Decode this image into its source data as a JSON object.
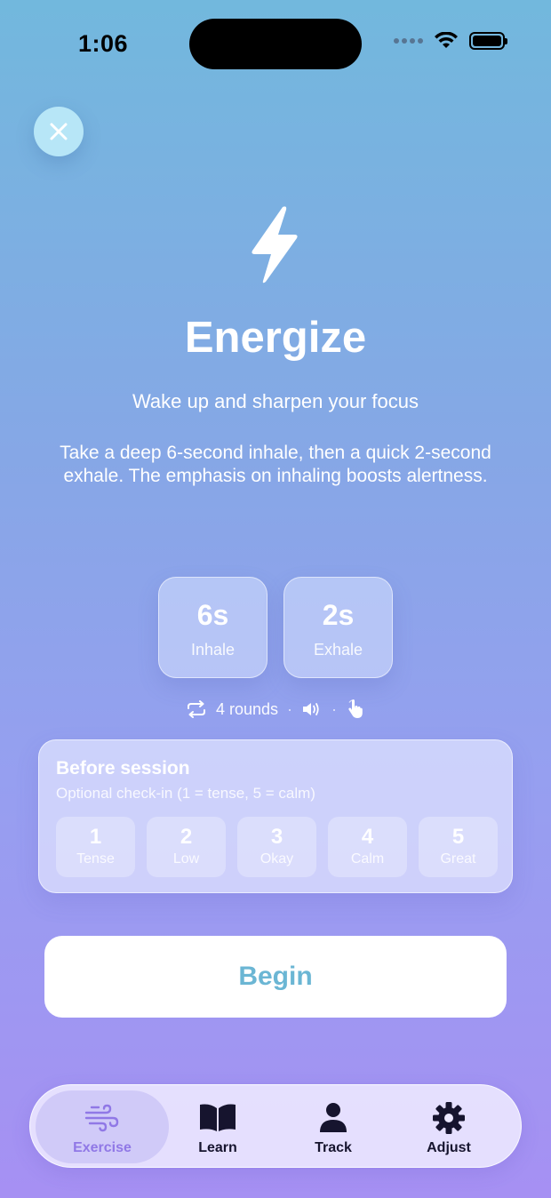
{
  "status_bar": {
    "time": "1:06"
  },
  "header": {
    "title": "Energize",
    "subtitle": "Wake up and sharpen your focus",
    "icon": "bolt-icon"
  },
  "description": "Take a deep 6-second inhale, then a quick 2-second exhale. The emphasis on inhaling boosts alertness.",
  "phases": [
    {
      "value": "6s",
      "label": "Inhale"
    },
    {
      "value": "2s",
      "label": "Exhale"
    }
  ],
  "meta": {
    "rounds": "4 rounds",
    "separator": "·"
  },
  "checkin": {
    "title": "Before session",
    "subtitle": "Optional check-in (1 = tense, 5 = calm)",
    "options": [
      {
        "num": "1",
        "word": "Tense"
      },
      {
        "num": "2",
        "word": "Low"
      },
      {
        "num": "3",
        "word": "Okay"
      },
      {
        "num": "4",
        "word": "Calm"
      },
      {
        "num": "5",
        "word": "Great"
      }
    ]
  },
  "begin_label": "Begin",
  "tabs": [
    {
      "label": "Exercise",
      "icon": "wind-icon",
      "active": true
    },
    {
      "label": "Learn",
      "icon": "book-icon",
      "active": false
    },
    {
      "label": "Track",
      "icon": "person-icon",
      "active": false
    },
    {
      "label": "Adjust",
      "icon": "gear-icon",
      "active": false
    }
  ],
  "colors": {
    "accent": "#6bb6d4",
    "tab_active": "#9078e6",
    "background_top": "#72b8dd",
    "background_bottom": "#a690f3"
  }
}
